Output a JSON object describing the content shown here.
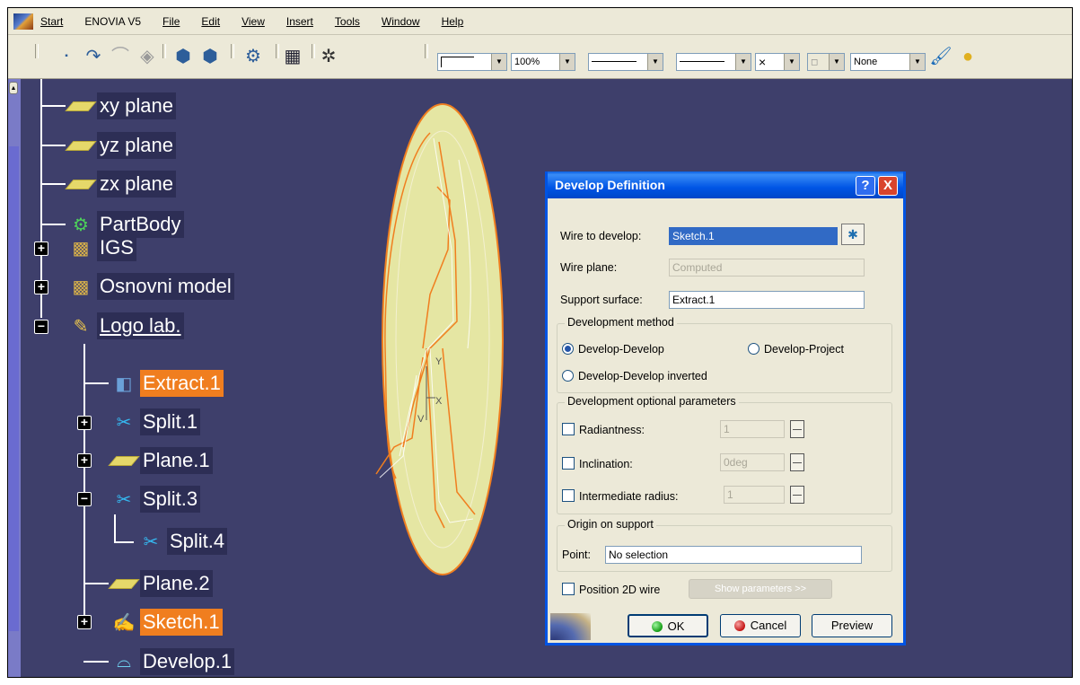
{
  "menu": {
    "items": [
      "Start",
      "ENOVIA V5",
      "File",
      "Edit",
      "View",
      "Insert",
      "Tools",
      "Window",
      "Help"
    ]
  },
  "toolbar": {
    "zoom_combo": "100%",
    "layer_combo": "None",
    "icons": [
      "point-icon",
      "curve-icon",
      "surface-icon",
      "eraser-icon",
      "cube-icon",
      "cube-alt-icon",
      "assembly-icon",
      "grid-icon",
      "star-icon",
      "paint-icon",
      "render-icon"
    ]
  },
  "tree": {
    "nodes": [
      {
        "label": "xy plane",
        "icon": "plane-icon"
      },
      {
        "label": "yz plane",
        "icon": "plane-icon"
      },
      {
        "label": "zx plane",
        "icon": "plane-icon"
      },
      {
        "label": "PartBody",
        "icon": "partbody-icon"
      },
      {
        "label": "IGS",
        "icon": "geoset-icon"
      },
      {
        "label": "Osnovni model",
        "icon": "geoset-icon"
      },
      {
        "label": "Logo lab.",
        "icon": "geoset-active-icon"
      },
      {
        "label": "Extract.1",
        "icon": "extract-icon"
      },
      {
        "label": "Split.1",
        "icon": "split-icon"
      },
      {
        "label": "Plane.1",
        "icon": "plane-icon"
      },
      {
        "label": "Split.3",
        "icon": "split-icon"
      },
      {
        "label": "Split.4",
        "icon": "split-icon"
      },
      {
        "label": "Plane.2",
        "icon": "plane-icon"
      },
      {
        "label": "Sketch.1",
        "icon": "sketch-icon"
      },
      {
        "label": "Develop.1",
        "icon": "develop-icon"
      }
    ]
  },
  "viewport": {
    "axis_y": "Y",
    "axis_x": "X",
    "axis_v": "V"
  },
  "dialog": {
    "title": "Develop Definition",
    "help_label": "?",
    "close_label": "X",
    "wire_label": "Wire to develop:",
    "wire_value": "Sketch.1",
    "plane_label": "Wire plane:",
    "plane_value": "Computed",
    "support_label": "Support surface:",
    "support_value": "Extract.1",
    "method_group": "Development method",
    "method_dd": "Develop-Develop",
    "method_dp": "Develop-Project",
    "method_ddi": "Develop-Develop inverted",
    "optional_group": "Development optional parameters",
    "radiant_label": "Radiantness:",
    "radiant_value": "1",
    "incl_label": "Inclination:",
    "incl_value": "0deg",
    "radius_label": "Intermediate radius:",
    "radius_value": "1",
    "origin_group": "Origin on support",
    "point_label": "Point:",
    "point_value": "No selection",
    "position_label": "Position 2D wire",
    "show_params": "Show parameters >>",
    "ok": "OK",
    "cancel": "Cancel",
    "preview": "Preview"
  },
  "colors": {
    "background": "#3e3f6b",
    "highlight": "#f07e1f",
    "surface": "#e3e39a",
    "wire": "#f07e1f"
  }
}
